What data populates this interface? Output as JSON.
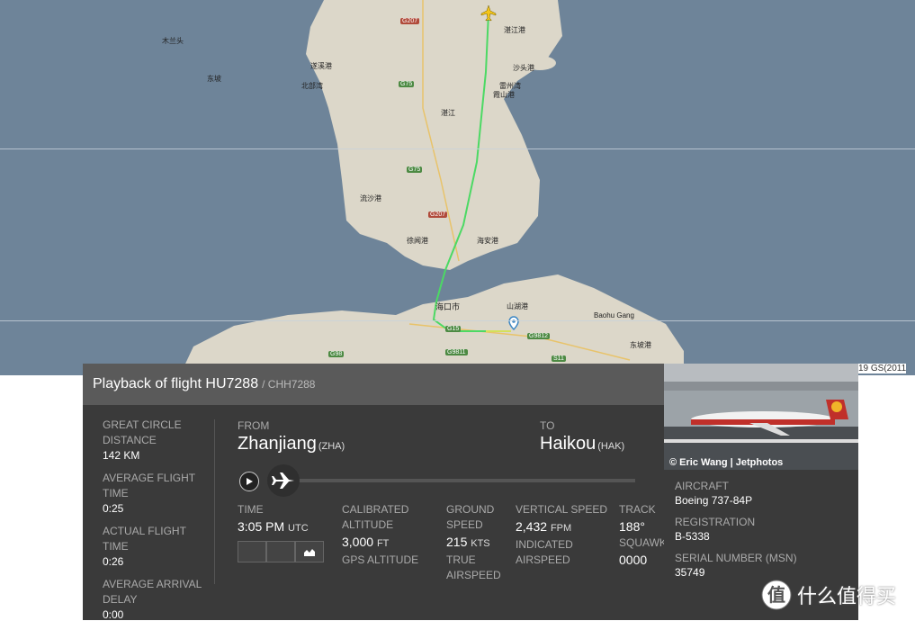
{
  "map": {
    "labels": [
      "东坡",
      "遂溪港",
      "徐闻港",
      "海安港",
      "湛江港",
      "海口市",
      "Baohu Gang",
      "山湖港",
      "东坡港",
      "霞山港",
      "沙头港",
      "北部湾",
      "木兰头",
      "流沙港",
      "雷州湾",
      "湛江"
    ],
    "roads": [
      "G207",
      "G75",
      "G75",
      "G207",
      "G15",
      "G15",
      "G9811",
      "G98",
      "S11",
      "G9812"
    ],
    "copyright": "19 GS(2011"
  },
  "panel": {
    "title": "Playback of flight HU7288",
    "callsign": "/ CHH7288",
    "great_circle_label": "GREAT CIRCLE DISTANCE",
    "great_circle_value": "142 KM",
    "avg_flight_label": "AVERAGE FLIGHT TIME",
    "avg_flight_value": "0:25",
    "actual_flight_label": "ACTUAL FLIGHT TIME",
    "actual_flight_value": "0:26",
    "avg_arrival_label": "AVERAGE ARRIVAL DELAY",
    "avg_arrival_value": "0:00",
    "from_label": "FROM",
    "from_airport": "Zhanjiang",
    "from_code": "(ZHA)",
    "to_label": "TO",
    "to_airport": "Haikou",
    "to_code": "(HAK)",
    "time_label": "TIME",
    "time_value": "3:05 PM",
    "time_unit": "UTC",
    "cal_alt_label": "CALIBRATED ALTITUDE",
    "cal_alt_value": "3,000",
    "cal_alt_unit": "FT",
    "gps_alt_label": "GPS ALTITUDE",
    "ground_speed_label": "GROUND SPEED",
    "ground_speed_value": "215",
    "ground_speed_unit": "KTS",
    "true_airspeed_label": "TRUE AIRSPEED",
    "vspeed_label": "VERTICAL SPEED",
    "vspeed_value": "2,432",
    "vspeed_unit": "FPM",
    "indicated_label": "INDICATED AIRSPEED",
    "track_label": "TRACK",
    "track_value": "188°",
    "squawk_label": "SQUAWK",
    "squawk_value": "0000"
  },
  "aircraft": {
    "photo_credit": "© Eric Wang | Jetphotos",
    "aircraft_label": "AIRCRAFT",
    "aircraft_value": "Boeing 737-84P",
    "registration_label": "REGISTRATION",
    "registration_value": "B-5338",
    "serial_label": "SERIAL NUMBER (MSN)",
    "serial_value": "35749"
  },
  "watermark": {
    "text": "什么值得买",
    "icon": "smzdm-logo-icon"
  },
  "colors": {
    "route": "#4cd964",
    "map_water": "#6e8499",
    "land": "#d9d4c7",
    "panel_bg": "#3a3a3a"
  }
}
